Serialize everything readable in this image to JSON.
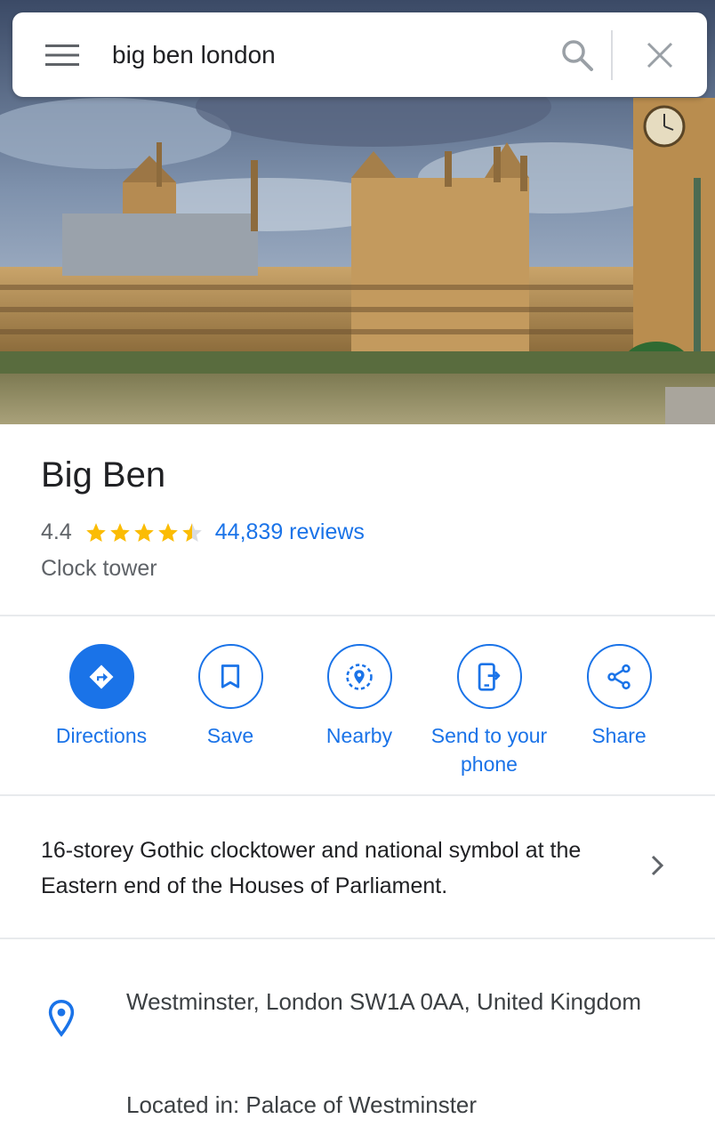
{
  "search": {
    "query": "big ben london",
    "menu_icon": "hamburger-menu-icon",
    "search_icon": "search-icon",
    "close_icon": "close-icon"
  },
  "hero": {
    "image_subject": "Palace of Westminster photo"
  },
  "place": {
    "name": "Big Ben",
    "rating": "4.4",
    "rating_value": 4.4,
    "rating_max": 5,
    "reviews": "44,839 reviews",
    "category": "Clock tower"
  },
  "actions": [
    {
      "label": "Directions",
      "icon": "directions-icon",
      "filled": true
    },
    {
      "label": "Save",
      "icon": "bookmark-icon",
      "filled": false
    },
    {
      "label": "Nearby",
      "icon": "nearby-icon",
      "filled": false
    },
    {
      "label": "Send to your phone",
      "icon": "send-to-phone-icon",
      "filled": false
    },
    {
      "label": "Share",
      "icon": "share-icon",
      "filled": false
    }
  ],
  "description": {
    "text": "16-storey Gothic clocktower and national symbol at the Eastern end of the Houses of Parliament."
  },
  "address": {
    "text": "Westminster, London SW1A 0AA, United Kingdom",
    "located_in": "Located in: Palace of Westminster"
  },
  "colors": {
    "accent": "#1a73e8",
    "star": "#fbbc04",
    "text_primary": "#202124",
    "text_secondary": "#5f6368"
  }
}
